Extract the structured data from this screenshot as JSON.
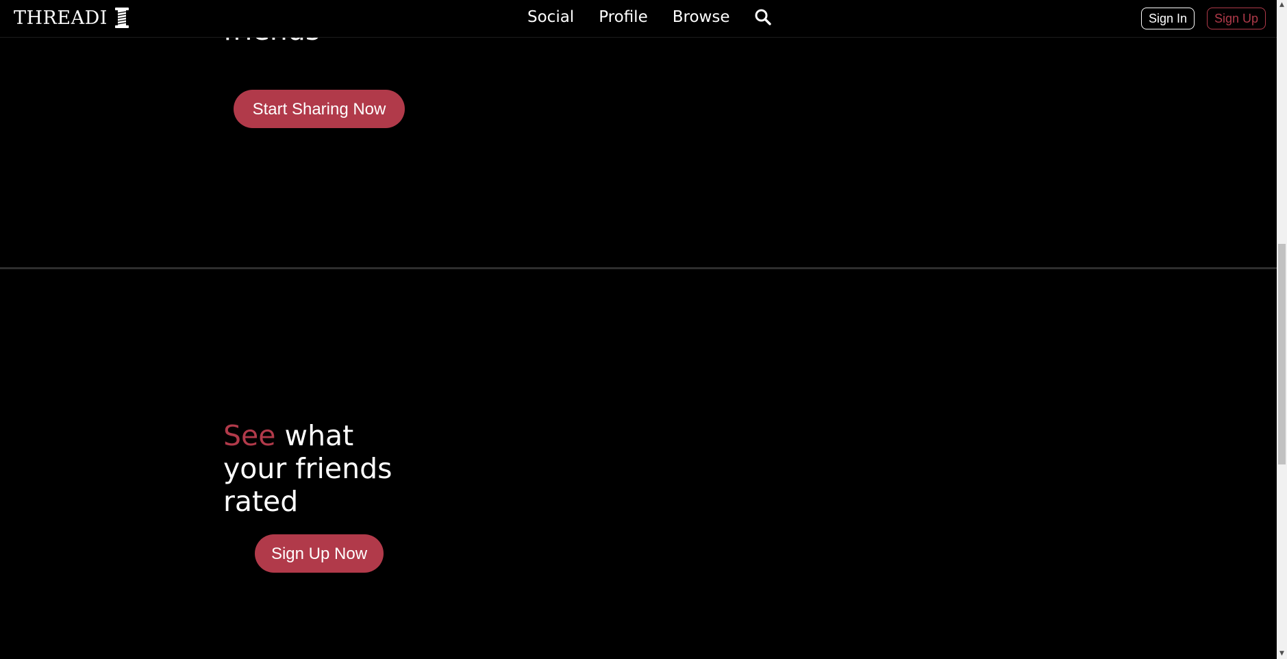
{
  "navbar": {
    "brand": "THREADI",
    "brand_icon": "spool-icon",
    "links": [
      {
        "label": "Social"
      },
      {
        "label": "Profile"
      },
      {
        "label": "Browse"
      }
    ],
    "search_icon": "search-icon",
    "sign_in": "Sign In",
    "sign_up": "Sign Up"
  },
  "section1": {
    "heading_visible": "friends",
    "button": "Start Sharing Now"
  },
  "section2": {
    "heading_accent": "See",
    "heading_rest": "what your friends rated",
    "button": "Sign Up Now"
  },
  "colors": {
    "accent": "#b13a4a",
    "background": "#000000",
    "text": "#ffffff"
  }
}
